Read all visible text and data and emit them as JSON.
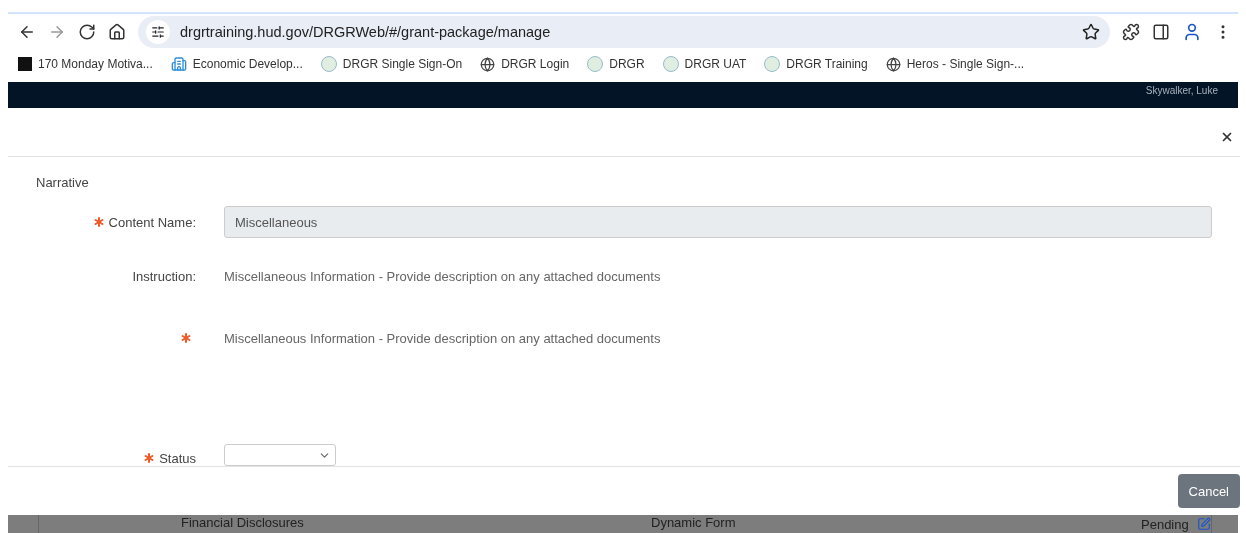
{
  "browser": {
    "url": "drgrtraining.hud.gov/DRGRWeb/#/grant-package/manage",
    "bookmarks": [
      {
        "label": "170 Monday Motiva...",
        "kind": "ep"
      },
      {
        "label": "Economic Develop...",
        "kind": "building"
      },
      {
        "label": "DRGR Single Sign-On",
        "kind": "seal"
      },
      {
        "label": "DRGR Login",
        "kind": "globe"
      },
      {
        "label": "DRGR",
        "kind": "seal"
      },
      {
        "label": "DRGR UAT",
        "kind": "seal"
      },
      {
        "label": "DRGR Training",
        "kind": "seal"
      },
      {
        "label": "Heros - Single Sign-...",
        "kind": "globe"
      }
    ]
  },
  "app_header": {
    "user": "Skywalker, Luke"
  },
  "modal": {
    "section": "Narrative",
    "fields": [
      {
        "kind": "input",
        "label": "Content Name:",
        "required": true,
        "value": "Miscellaneous",
        "disabled": true
      },
      {
        "kind": "text",
        "label": "Instruction:",
        "required": false,
        "value": "Miscellaneous Information - Provide description on any attached documents"
      },
      {
        "kind": "text",
        "required": true,
        "value": "Miscellaneous Information - Provide description on any attached documents"
      },
      {
        "kind": "select",
        "label": "Status",
        "required": true
      }
    ],
    "buttons": [
      "Cancel"
    ]
  },
  "background_row": [
    "Financial Disclosures",
    "Dynamic Form",
    "Pending"
  ]
}
